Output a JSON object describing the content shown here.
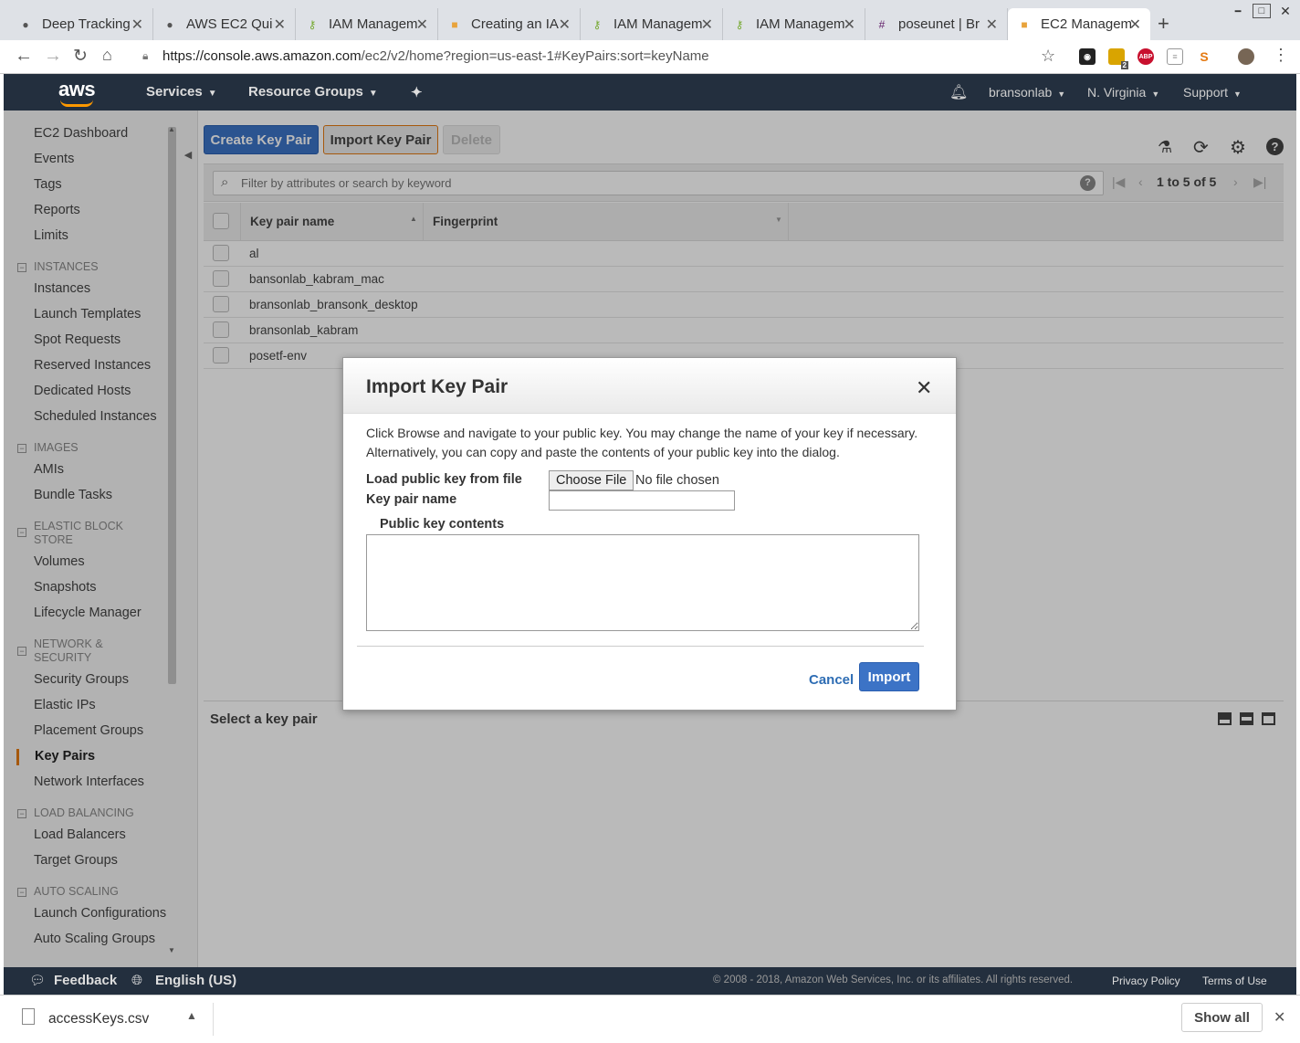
{
  "browser": {
    "tabs": [
      {
        "title": "Deep Tracking",
        "icon": "github-icon"
      },
      {
        "title": "AWS EC2 Qui",
        "icon": "github-icon"
      },
      {
        "title": "IAM Managem",
        "icon": "key-icon"
      },
      {
        "title": "Creating an IA",
        "icon": "aws-box-icon"
      },
      {
        "title": "IAM Managem",
        "icon": "key-icon"
      },
      {
        "title": "IAM Managem",
        "icon": "key-icon"
      },
      {
        "title": "poseunet | Br",
        "icon": "slack-icon"
      },
      {
        "title": "EC2 Managem",
        "icon": "aws-box-icon"
      }
    ],
    "url_prefix": "https://console.aws.amazon.com",
    "url_path": "/ec2/v2/home?region=us-east-1#KeyPairs:sort=keyName",
    "ext_badge": "2",
    "abp": "ABP"
  },
  "aws_nav": {
    "logo": "aws",
    "services": "Services",
    "resource_groups": "Resource Groups",
    "account": "bransonlab",
    "region": "N. Virginia",
    "support": "Support"
  },
  "sidebar": {
    "top": [
      "EC2 Dashboard",
      "Events",
      "Tags",
      "Reports",
      "Limits"
    ],
    "instances_header": "INSTANCES",
    "instances": [
      "Instances",
      "Launch Templates",
      "Spot Requests",
      "Reserved Instances",
      "Dedicated Hosts",
      "Scheduled Instances"
    ],
    "images_header": "IMAGES",
    "images": [
      "AMIs",
      "Bundle Tasks"
    ],
    "ebs_header_1": "ELASTIC BLOCK",
    "ebs_header_2": "STORE",
    "ebs": [
      "Volumes",
      "Snapshots",
      "Lifecycle Manager"
    ],
    "network_header_1": "NETWORK &",
    "network_header_2": "SECURITY",
    "network": [
      "Security Groups",
      "Elastic IPs",
      "Placement Groups",
      "Key Pairs",
      "Network Interfaces"
    ],
    "lb_header": "LOAD BALANCING",
    "lb": [
      "Load Balancers",
      "Target Groups"
    ],
    "as_header": "AUTO SCALING",
    "as": [
      "Launch Configurations",
      "Auto Scaling Groups"
    ]
  },
  "toolbar": {
    "create": "Create Key Pair",
    "import": "Import Key Pair",
    "delete": "Delete"
  },
  "filter": {
    "placeholder": "Filter by attributes or search by keyword",
    "help": "?",
    "pager": "1 to 5 of 5"
  },
  "table": {
    "col_name": "Key pair name",
    "col_fingerprint": "Fingerprint",
    "rows": [
      "al",
      "bansonlab_kabram_mac",
      "bransonlab_bransonk_desktop",
      "bransonlab_kabram",
      "posetf-env"
    ]
  },
  "detail": {
    "title": "Select a key pair"
  },
  "modal": {
    "title": "Import Key Pair",
    "description": "Click Browse and navigate to your public key. You may change the name of your key if necessary. Alternatively, you can copy and paste the contents of your public key into the dialog.",
    "load_label": "Load public key from file",
    "choose_file": "Choose File",
    "no_file": "No file chosen",
    "name_label": "Key pair name",
    "name_value": "",
    "contents_label": "Public key contents",
    "contents_value": "",
    "cancel": "Cancel",
    "import": "Import"
  },
  "footer": {
    "feedback": "Feedback",
    "language": "English (US)",
    "copyright": "© 2008 - 2018, Amazon Web Services, Inc. or its affiliates. All rights reserved.",
    "privacy": "Privacy Policy",
    "terms": "Terms of Use"
  },
  "downloads": {
    "file": "accessKeys.csv",
    "show_all": "Show all"
  },
  "colors": {
    "aws_nav": "#232f3e",
    "primary_button": "#3c73c6",
    "active_accent": "#e47911"
  }
}
